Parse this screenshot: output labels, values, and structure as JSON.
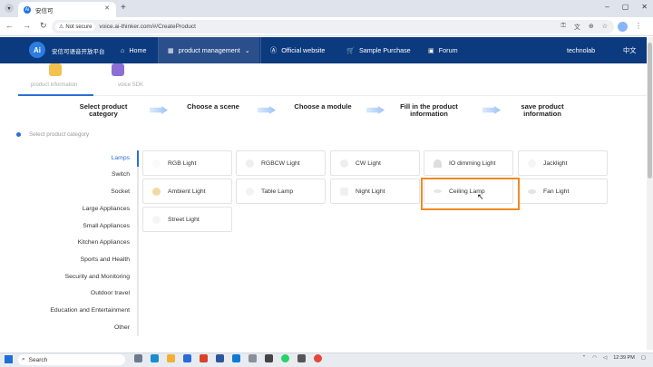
{
  "browser": {
    "tab_title": "安信可",
    "new_tab": "+",
    "security_label": "Not secure",
    "url": "voice.ai-thinker.com/#/CreateProduct",
    "window_controls": [
      "–",
      "▢",
      "✕"
    ]
  },
  "site": {
    "logo_text": "Ai",
    "brand": "安信可语音开放平台",
    "nav": {
      "home": "Home",
      "product_management": "product management",
      "official_website": "Official website",
      "sample_purchase": "Sample Purchase",
      "forum": "Forum",
      "user": "technolab",
      "language": "中文"
    }
  },
  "top_tabs": {
    "product_information": "product information",
    "voice_sdk": "voice SDK"
  },
  "steps": [
    "Select product category",
    "Choose a scene",
    "Choose a module",
    "Fill in the product information",
    "save product information"
  ],
  "select_category_label": "Select product category",
  "categories": [
    "Lamps",
    "Switch",
    "Socket",
    "Large Appliances",
    "Small Appliances",
    "Kitchen Appliances",
    "Sports and Health",
    "Security and Monitoring",
    "Outdoor travel",
    "Education and Entertainment",
    "Other"
  ],
  "active_category": "Lamps",
  "products": [
    "RGB Light",
    "RGBCW Light",
    "CW Light",
    "IO dimming Light",
    "Jacklight",
    "Ambient Light",
    "Table Lamp",
    "Night Light",
    "Ceiling Lamp",
    "Fan Light",
    "Street Light"
  ],
  "highlighted_product": "Ceiling Lamp",
  "taskbar": {
    "search_label": "Search",
    "time": "12:39 PM"
  },
  "colors": {
    "nav_bg": "#0b3a7e",
    "accent": "#2b6fd6",
    "highlight": "#f08a24"
  }
}
